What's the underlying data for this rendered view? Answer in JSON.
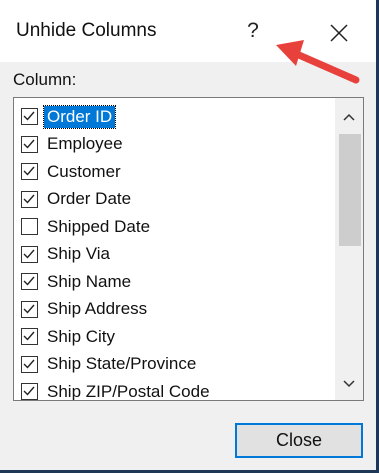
{
  "dialog": {
    "title": "Unhide Columns",
    "help_label": "?",
    "close_icon": "close-icon",
    "accent_color": "#0078d7",
    "annotation_arrow_color": "#e8413c"
  },
  "list": {
    "label": "Column:",
    "items": [
      {
        "label": "Order ID",
        "checked": true,
        "selected": true
      },
      {
        "label": "Employee",
        "checked": true,
        "selected": false
      },
      {
        "label": "Customer",
        "checked": true,
        "selected": false
      },
      {
        "label": "Order Date",
        "checked": true,
        "selected": false
      },
      {
        "label": "Shipped Date",
        "checked": false,
        "selected": false
      },
      {
        "label": "Ship Via",
        "checked": true,
        "selected": false
      },
      {
        "label": "Ship Name",
        "checked": true,
        "selected": false
      },
      {
        "label": "Ship Address",
        "checked": true,
        "selected": false
      },
      {
        "label": "Ship City",
        "checked": true,
        "selected": false
      },
      {
        "label": "Ship State/Province",
        "checked": true,
        "selected": false
      },
      {
        "label": "Ship ZIP/Postal Code",
        "checked": true,
        "selected": false
      }
    ]
  },
  "buttons": {
    "close_label": "Close"
  }
}
